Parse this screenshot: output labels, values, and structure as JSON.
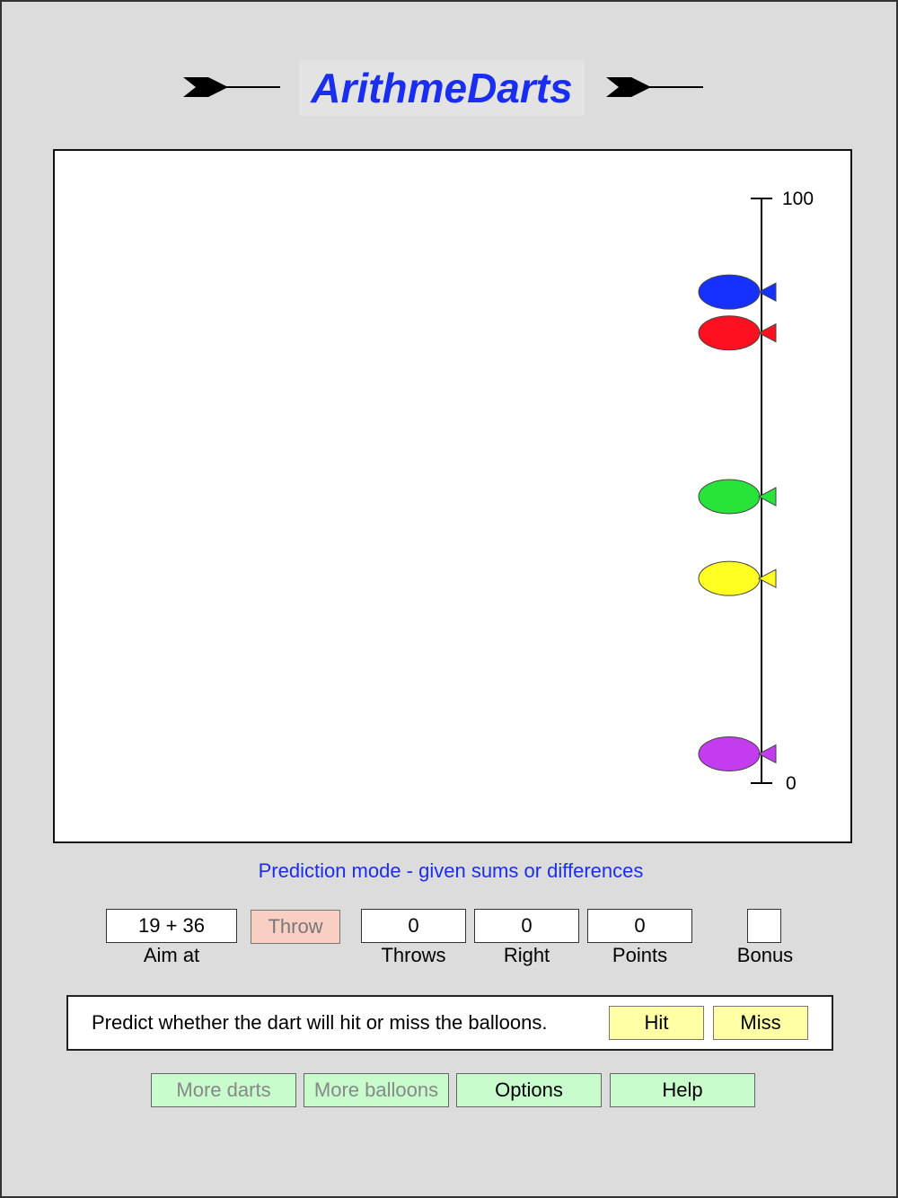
{
  "app": {
    "title": "ArithmeDarts"
  },
  "scale": {
    "top_label": "100",
    "bottom_label": "0",
    "min": 0,
    "max": 100
  },
  "balloons": [
    {
      "color": "#1530ff",
      "value": 84
    },
    {
      "color": "#ff1020",
      "value": 77
    },
    {
      "color": "#27e33a",
      "value": 49
    },
    {
      "color": "#ffff22",
      "value": 35
    },
    {
      "color": "#c33cf0",
      "value": 5
    }
  ],
  "mode_text": "Prediction mode - given sums or differences",
  "controls": {
    "aim_value": "19 + 36",
    "aim_label": "Aim at",
    "throw_label": "Throw",
    "throws_value": "0",
    "throws_label": "Throws",
    "right_value": "0",
    "right_label": "Right",
    "points_value": "0",
    "points_label": "Points",
    "bonus_value": "",
    "bonus_label": "Bonus"
  },
  "prediction": {
    "prompt": "Predict whether the dart will hit or miss the balloons.",
    "hit_label": "Hit",
    "miss_label": "Miss"
  },
  "bottom_buttons": {
    "more_darts": "More darts",
    "more_balloons": "More balloons",
    "options": "Options",
    "help": "Help"
  }
}
